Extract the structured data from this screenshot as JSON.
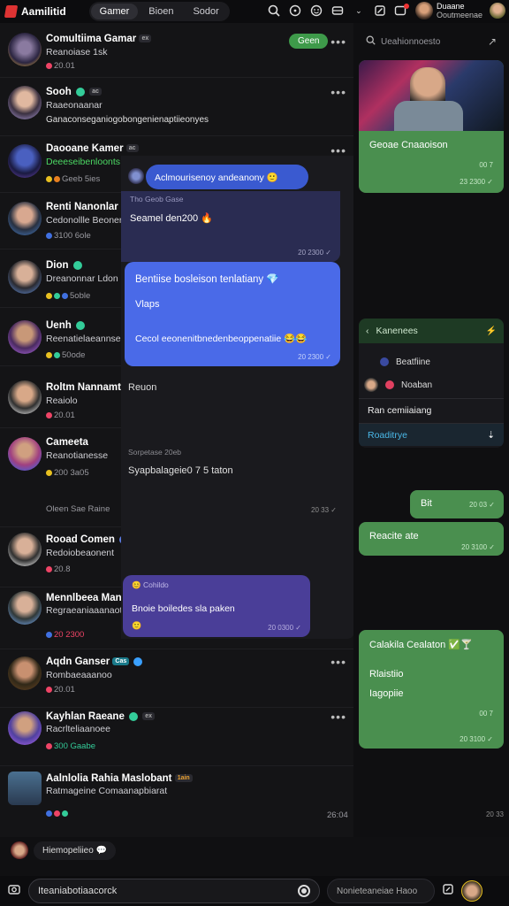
{
  "brand": {
    "title": "Aamilitid"
  },
  "tabs": [
    {
      "label": "Gamer"
    },
    {
      "label": "Bioen"
    },
    {
      "label": "Sodor"
    }
  ],
  "top_user": {
    "name": "Duaane",
    "sub": "Ooutmeenae"
  },
  "pinned": {
    "title": "Comultiima Gamar",
    "badge": "ex",
    "sub": "Reanoiase 1sk",
    "meta": "20.01",
    "join": "Geen"
  },
  "threads": [
    {
      "name": "Sooh",
      "badge": "ac",
      "sub": "Raaeonaanar",
      "preview": "Ganaconseganiogobongenienaptiieonyes",
      "meta": ""
    },
    {
      "name": "Daooane Kamer",
      "badge": "ac",
      "sub": "Deeeseibenloonts",
      "preview": "",
      "meta": "Geeb 5ies"
    },
    {
      "name": "Renti Nanonlar",
      "badge": "",
      "sub": "Cedonollle Beoner",
      "preview": "",
      "meta": "3100 6ole"
    },
    {
      "name": "Dion",
      "badge": "",
      "sub": "Dreanonnar Ldon",
      "preview": "",
      "meta": "5oble"
    },
    {
      "name": "Uenh",
      "badge": "",
      "sub": "Reenatielaeannsen",
      "preview": "",
      "meta": "50ode"
    },
    {
      "name": "Roltm Nannamtinn",
      "badge": "",
      "sub": "Reaiolo",
      "preview": "",
      "meta": "20.01"
    },
    {
      "name": "Cameeta",
      "badge": "",
      "sub": "Reanotianesse",
      "preview": "Oleen Sae Raine",
      "meta": "200 3a05"
    },
    {
      "name": "Rooad Comen",
      "badge": "",
      "sub": "Redoiobeaonent",
      "preview": "",
      "meta": "20.8"
    },
    {
      "name": "Mennlbeea Mantes",
      "badge": "",
      "sub": "Regraeaniaaanaotis",
      "preview": "",
      "meta": "20 2300"
    },
    {
      "name": "Aqdn Ganser",
      "badge": "Cas",
      "sub": "Rombaeaaanoo",
      "preview": "",
      "meta": "20.01"
    },
    {
      "name": "Kayhlan Raeane",
      "badge": "ex",
      "sub": "Racrlteliaanoee",
      "preview": "",
      "meta": "300 Gaabe"
    },
    {
      "name": "Aalnlolia Rahia Maslobant",
      "badge": "1ain",
      "sub": "Ratmageine Comaanapbiarat",
      "preview": "",
      "meta": "26:04"
    }
  ],
  "overlay": {
    "top_bubble": "Aclmourisenoy andeanony",
    "header_sub": "Tho Geob Gase",
    "main_line": "Seamel den200",
    "main_ts": "20 2300",
    "blue_title": "Bentiise bosleison tenlatiany",
    "blue_sub": "Vlaps",
    "blue_body": "Cecol eeonenitbnedenbeoppenatiie",
    "blue_ts": "20 2300",
    "reaction_label": "Reuon",
    "section_header": "Sorpetase 20eb",
    "section_line": "Syapbalageie0 7 5 taton",
    "section_ts": "20 33",
    "purple_meta": "Cohildo",
    "purple_text": "Bnoie boiledes sla paken",
    "purple_ts": "20 0300"
  },
  "right": {
    "search_placeholder": "Ueahionnoesto",
    "video_caption": "Geoae Cnaaoison",
    "video_ts": "23 2300",
    "video_meta": "00 7",
    "panel_title": "Kanenees",
    "options": [
      {
        "label": "Beatfiine"
      },
      {
        "label": "Noaban"
      },
      {
        "label": "Ran cemiiaiang"
      },
      {
        "label": "Roaditrye"
      }
    ],
    "msg1": "Bit",
    "msg1_ts": "20 03",
    "msg2": "Reacite ate",
    "msg2_ts": "20 3100",
    "msg3_title": "Calakila Cealaton",
    "msg3_l1": "Rlaistiio",
    "msg3_l2": "Iagopiie",
    "msg3_meta": "00 7",
    "msg3_ts": "20 3100",
    "bottom_ts": "20 33"
  },
  "footer": {
    "chip": "Hiemopeliieo",
    "input_placeholder": "Iteaniabotiaacorck",
    "right_input": "Nonieteaneiae Haoo"
  }
}
